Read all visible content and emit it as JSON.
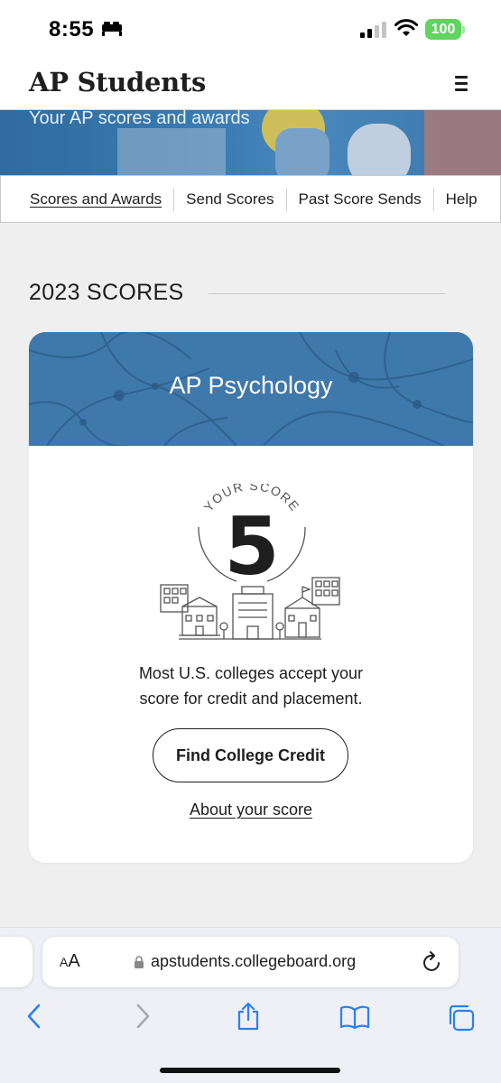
{
  "status_bar": {
    "time": "8:55",
    "battery": "100",
    "icons": [
      "bed-icon",
      "cellular-signal-icon",
      "wifi-icon",
      "battery-icon"
    ]
  },
  "header": {
    "title": "AP Students",
    "menu_icon": "hamburger-menu-icon"
  },
  "hero": {
    "subtitle": "Your AP scores and awards"
  },
  "subnav": {
    "items": [
      {
        "label": "Scores and Awards",
        "active": true
      },
      {
        "label": "Send Scores"
      },
      {
        "label": "Past Score Sends"
      },
      {
        "label": "Help"
      }
    ]
  },
  "section": {
    "title": "2023 SCORES"
  },
  "score_card": {
    "subject": "AP Psychology",
    "score_label": "YOUR SCORE",
    "score": "5",
    "message_line1": "Most U.S. colleges accept your",
    "message_line2": "score for credit and placement.",
    "button_label": "Find College Credit",
    "link_label": "About your score"
  },
  "browser": {
    "aa_label_small": "A",
    "aa_label_large": "A",
    "url": "apstudents.collegeboard.org",
    "toolbar_icons": [
      "back-icon",
      "forward-icon",
      "share-icon",
      "bookmarks-icon",
      "tabs-icon"
    ]
  },
  "colors": {
    "banner_blue": "#3f78ab",
    "battery_green": "#5fd45f",
    "page_background": "#efefef"
  }
}
